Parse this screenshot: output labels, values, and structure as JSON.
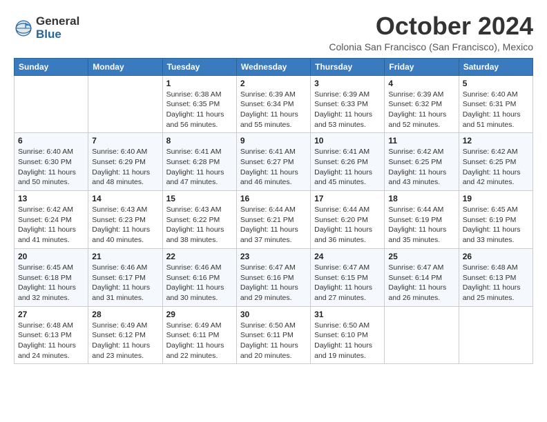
{
  "header": {
    "logo_general": "General",
    "logo_blue": "Blue",
    "month_title": "October 2024",
    "subtitle": "Colonia San Francisco (San Francisco), Mexico"
  },
  "days_of_week": [
    "Sunday",
    "Monday",
    "Tuesday",
    "Wednesday",
    "Thursday",
    "Friday",
    "Saturday"
  ],
  "weeks": [
    [
      {
        "day": "",
        "info": ""
      },
      {
        "day": "",
        "info": ""
      },
      {
        "day": "1",
        "info": "Sunrise: 6:38 AM\nSunset: 6:35 PM\nDaylight: 11 hours and 56 minutes."
      },
      {
        "day": "2",
        "info": "Sunrise: 6:39 AM\nSunset: 6:34 PM\nDaylight: 11 hours and 55 minutes."
      },
      {
        "day": "3",
        "info": "Sunrise: 6:39 AM\nSunset: 6:33 PM\nDaylight: 11 hours and 53 minutes."
      },
      {
        "day": "4",
        "info": "Sunrise: 6:39 AM\nSunset: 6:32 PM\nDaylight: 11 hours and 52 minutes."
      },
      {
        "day": "5",
        "info": "Sunrise: 6:40 AM\nSunset: 6:31 PM\nDaylight: 11 hours and 51 minutes."
      }
    ],
    [
      {
        "day": "6",
        "info": "Sunrise: 6:40 AM\nSunset: 6:30 PM\nDaylight: 11 hours and 50 minutes."
      },
      {
        "day": "7",
        "info": "Sunrise: 6:40 AM\nSunset: 6:29 PM\nDaylight: 11 hours and 48 minutes."
      },
      {
        "day": "8",
        "info": "Sunrise: 6:41 AM\nSunset: 6:28 PM\nDaylight: 11 hours and 47 minutes."
      },
      {
        "day": "9",
        "info": "Sunrise: 6:41 AM\nSunset: 6:27 PM\nDaylight: 11 hours and 46 minutes."
      },
      {
        "day": "10",
        "info": "Sunrise: 6:41 AM\nSunset: 6:26 PM\nDaylight: 11 hours and 45 minutes."
      },
      {
        "day": "11",
        "info": "Sunrise: 6:42 AM\nSunset: 6:25 PM\nDaylight: 11 hours and 43 minutes."
      },
      {
        "day": "12",
        "info": "Sunrise: 6:42 AM\nSunset: 6:25 PM\nDaylight: 11 hours and 42 minutes."
      }
    ],
    [
      {
        "day": "13",
        "info": "Sunrise: 6:42 AM\nSunset: 6:24 PM\nDaylight: 11 hours and 41 minutes."
      },
      {
        "day": "14",
        "info": "Sunrise: 6:43 AM\nSunset: 6:23 PM\nDaylight: 11 hours and 40 minutes."
      },
      {
        "day": "15",
        "info": "Sunrise: 6:43 AM\nSunset: 6:22 PM\nDaylight: 11 hours and 38 minutes."
      },
      {
        "day": "16",
        "info": "Sunrise: 6:44 AM\nSunset: 6:21 PM\nDaylight: 11 hours and 37 minutes."
      },
      {
        "day": "17",
        "info": "Sunrise: 6:44 AM\nSunset: 6:20 PM\nDaylight: 11 hours and 36 minutes."
      },
      {
        "day": "18",
        "info": "Sunrise: 6:44 AM\nSunset: 6:19 PM\nDaylight: 11 hours and 35 minutes."
      },
      {
        "day": "19",
        "info": "Sunrise: 6:45 AM\nSunset: 6:19 PM\nDaylight: 11 hours and 33 minutes."
      }
    ],
    [
      {
        "day": "20",
        "info": "Sunrise: 6:45 AM\nSunset: 6:18 PM\nDaylight: 11 hours and 32 minutes."
      },
      {
        "day": "21",
        "info": "Sunrise: 6:46 AM\nSunset: 6:17 PM\nDaylight: 11 hours and 31 minutes."
      },
      {
        "day": "22",
        "info": "Sunrise: 6:46 AM\nSunset: 6:16 PM\nDaylight: 11 hours and 30 minutes."
      },
      {
        "day": "23",
        "info": "Sunrise: 6:47 AM\nSunset: 6:16 PM\nDaylight: 11 hours and 29 minutes."
      },
      {
        "day": "24",
        "info": "Sunrise: 6:47 AM\nSunset: 6:15 PM\nDaylight: 11 hours and 27 minutes."
      },
      {
        "day": "25",
        "info": "Sunrise: 6:47 AM\nSunset: 6:14 PM\nDaylight: 11 hours and 26 minutes."
      },
      {
        "day": "26",
        "info": "Sunrise: 6:48 AM\nSunset: 6:13 PM\nDaylight: 11 hours and 25 minutes."
      }
    ],
    [
      {
        "day": "27",
        "info": "Sunrise: 6:48 AM\nSunset: 6:13 PM\nDaylight: 11 hours and 24 minutes."
      },
      {
        "day": "28",
        "info": "Sunrise: 6:49 AM\nSunset: 6:12 PM\nDaylight: 11 hours and 23 minutes."
      },
      {
        "day": "29",
        "info": "Sunrise: 6:49 AM\nSunset: 6:11 PM\nDaylight: 11 hours and 22 minutes."
      },
      {
        "day": "30",
        "info": "Sunrise: 6:50 AM\nSunset: 6:11 PM\nDaylight: 11 hours and 20 minutes."
      },
      {
        "day": "31",
        "info": "Sunrise: 6:50 AM\nSunset: 6:10 PM\nDaylight: 11 hours and 19 minutes."
      },
      {
        "day": "",
        "info": ""
      },
      {
        "day": "",
        "info": ""
      }
    ]
  ]
}
